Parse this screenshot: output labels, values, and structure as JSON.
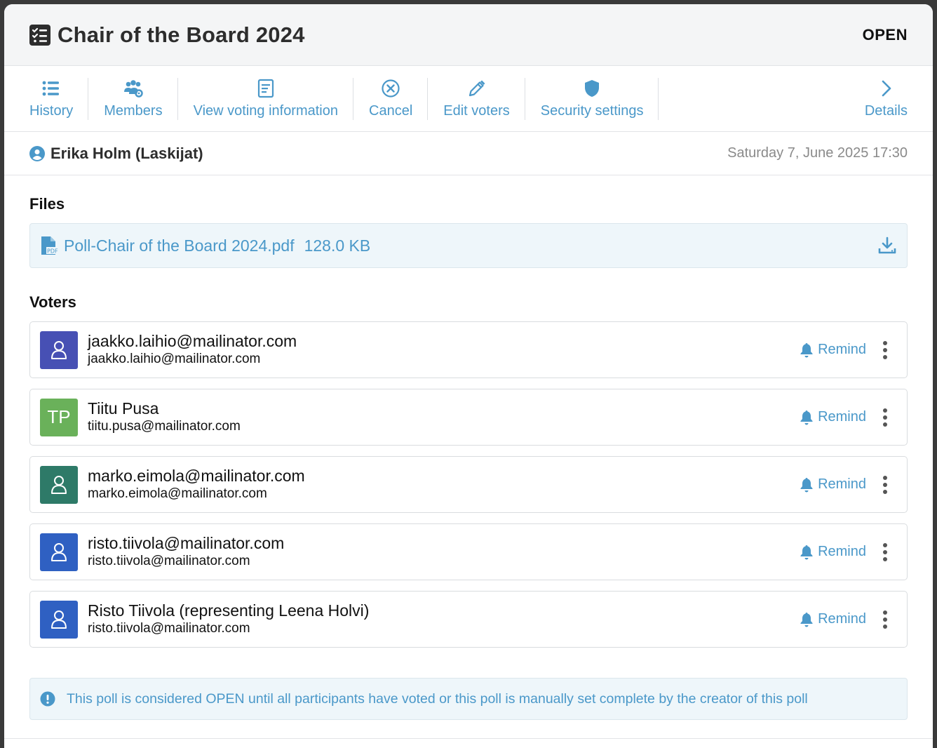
{
  "header": {
    "title": "Chair of the Board 2024",
    "status": "OPEN",
    "icon": "checklist-icon"
  },
  "toolbar": {
    "items": [
      {
        "label": "History",
        "icon": "list-icon"
      },
      {
        "label": "Members",
        "icon": "users-gear-icon"
      },
      {
        "label": "View voting information",
        "icon": "document-icon"
      },
      {
        "label": "Cancel",
        "icon": "close-circle-icon"
      },
      {
        "label": "Edit voters",
        "icon": "pencil-icon"
      },
      {
        "label": "Security settings",
        "icon": "shield-icon"
      },
      {
        "label": "Details",
        "icon": "chevron-right-icon"
      }
    ]
  },
  "creator": {
    "name": "Erika Holm (Laskijat)",
    "date": "Saturday 7, June 2025 17:30"
  },
  "files": {
    "title": "Files",
    "items": [
      {
        "name": "Poll-Chair of the Board 2024.pdf",
        "size": "128.0 KB"
      }
    ]
  },
  "voters": {
    "title": "Voters",
    "remind_label": "Remind",
    "items": [
      {
        "name": "jaakko.laihio@mailinator.com",
        "email": "jaakko.laihio@mailinator.com",
        "initials": "",
        "color": "#4750b4"
      },
      {
        "name": "Tiitu Pusa",
        "email": "tiitu.pusa@mailinator.com",
        "initials": "TP",
        "color": "#6ab15a"
      },
      {
        "name": "marko.eimola@mailinator.com",
        "email": "marko.eimola@mailinator.com",
        "initials": "",
        "color": "#2e7a68"
      },
      {
        "name": "risto.tiivola@mailinator.com",
        "email": "risto.tiivola@mailinator.com",
        "initials": "",
        "color": "#2f60c2"
      },
      {
        "name": "Risto Tiivola (representing Leena Holvi)",
        "email": "risto.tiivola@mailinator.com",
        "initials": "",
        "color": "#2f60c2"
      }
    ]
  },
  "info": {
    "text": "This poll is considered OPEN until all participants have voted or this poll is manually set complete by the creator of this poll"
  },
  "colors": {
    "accent": "#4a98c9",
    "info_bg": "#eef6fa"
  }
}
